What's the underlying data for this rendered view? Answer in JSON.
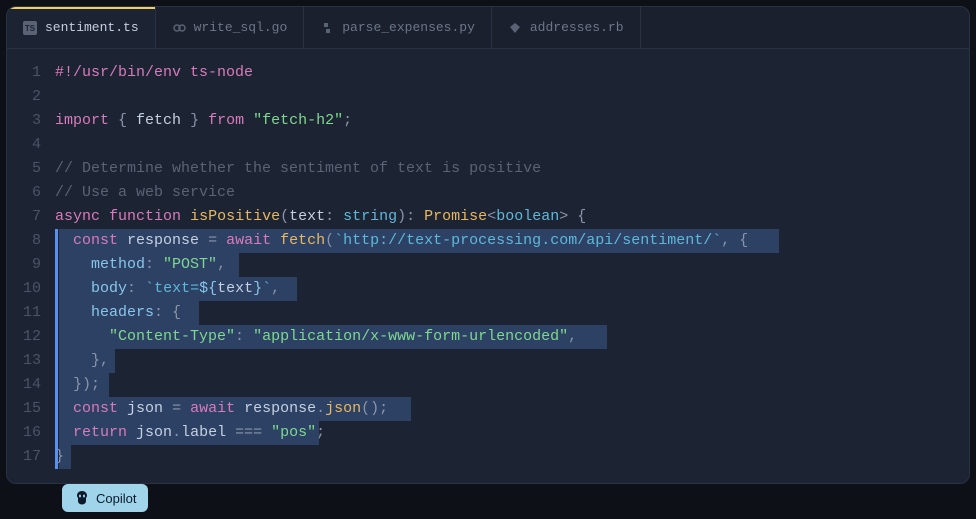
{
  "tabs": [
    {
      "name": "sentiment.ts",
      "icon": "ts",
      "active": true
    },
    {
      "name": "write_sql.go",
      "icon": "go",
      "active": false
    },
    {
      "name": "parse_expenses.py",
      "icon": "py",
      "active": false
    },
    {
      "name": "addresses.rb",
      "icon": "rb",
      "active": false
    }
  ],
  "copilot_label": "Copilot",
  "line_count": 17,
  "code": {
    "l1": {
      "shebang": "#!/usr/bin/env ts-node"
    },
    "l3": {
      "kw_import": "import",
      "brace_open": "{ ",
      "ident": "fetch",
      "brace_close": " }",
      "kw_from": "from",
      "str": "\"fetch-h2\"",
      "semi": ";"
    },
    "l5": {
      "comment": "// Determine whether the sentiment of text is positive"
    },
    "l6": {
      "comment": "// Use a web service"
    },
    "l7": {
      "kw_async": "async",
      "kw_function": "function",
      "fn": "isPositive",
      "p_open": "(",
      "param": "text",
      "colon": ": ",
      "ptype": "string",
      "p_close": ")",
      "ret_colon": ": ",
      "ret_type": "Promise",
      "lt": "<",
      "gtype": "boolean",
      "gt": ">",
      "brace": " {"
    },
    "l8": {
      "indent": "  ",
      "kw_const": "const",
      "var": "response",
      "eq": " = ",
      "kw_await": "await",
      "fn": "fetch",
      "p_open": "(",
      "tick1": "`",
      "url": "http://text-processing.com/api/sentiment/",
      "tick2": "`",
      "comma": ", {"
    },
    "l9": {
      "indent": "    ",
      "prop": "method",
      "colon": ": ",
      "val": "\"POST\"",
      "comma": ","
    },
    "l10": {
      "indent": "    ",
      "prop": "body",
      "colon": ": ",
      "tick1": "`",
      "tpl1": "text=",
      "interp_open": "${",
      "interp_var": "text",
      "interp_close": "}",
      "tick2": "`",
      "comma": ","
    },
    "l11": {
      "indent": "    ",
      "prop": "headers",
      "colon": ": {",
      "rest": ""
    },
    "l12": {
      "indent": "      ",
      "key": "\"Content-Type\"",
      "colon": ": ",
      "val": "\"application/x-www-form-urlencoded\"",
      "comma": ","
    },
    "l13": {
      "indent": "    ",
      "close": "},"
    },
    "l14": {
      "indent": "  ",
      "close": "});"
    },
    "l15": {
      "indent": "  ",
      "kw_const": "const",
      "var": "json",
      "eq": " = ",
      "kw_await": "await",
      "sp": " ",
      "obj": "response",
      "dot": ".",
      "method": "json",
      "call": "();"
    },
    "l16": {
      "indent": "  ",
      "kw_return": "return",
      "sp": " ",
      "obj": "json",
      "dot": ".",
      "prop": "label",
      "op": " === ",
      "val": "\"pos\"",
      "semi": ";"
    },
    "l17": {
      "close": "}"
    }
  }
}
